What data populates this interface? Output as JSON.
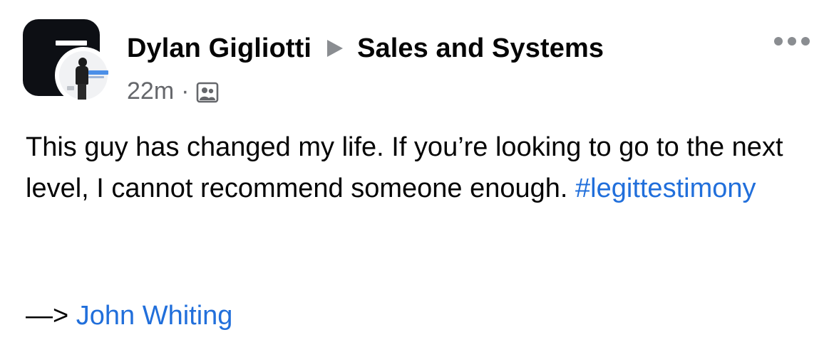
{
  "post": {
    "author": "Dylan Gigliotti",
    "group": "Sales and Systems",
    "timestamp": "22m",
    "separator": "·",
    "audience_icon": "group-photo-icon",
    "more_icon": "ellipsis-icon",
    "body_text": "This guy has changed my life. If you’re looking to go to the next level, I cannot recommend someone enough.",
    "hashtag": "#legittestimony",
    "mention_prefix": "—>",
    "mention_name": "John Whiting"
  },
  "colors": {
    "text": "#050505",
    "secondary": "#65676b",
    "link": "#216fdb",
    "icon_gray": "#8a8d91"
  }
}
